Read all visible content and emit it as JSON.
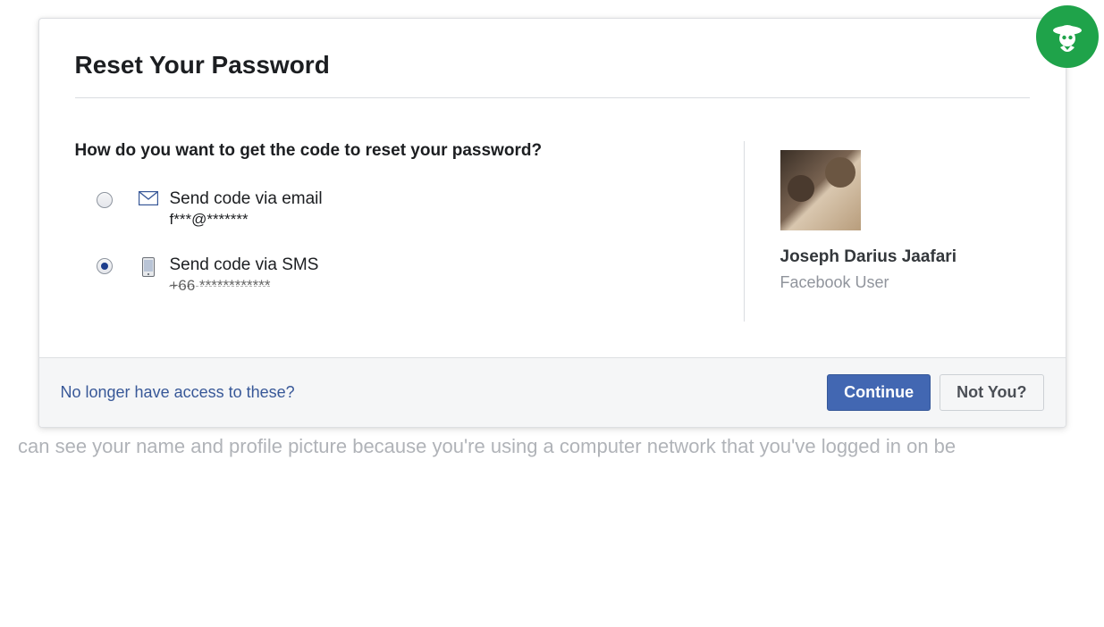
{
  "title": "Reset Your Password",
  "prompt": "How do you want to get the code to reset your password?",
  "options": {
    "email": {
      "label": "Send code via email",
      "detail": "f***@*******",
      "selected": false
    },
    "sms": {
      "label": "Send code via SMS",
      "detail": "+66 ************",
      "selected": true
    }
  },
  "user": {
    "name": "Joseph Darius Jaafari",
    "role": "Facebook User"
  },
  "footer": {
    "no_access_link": "No longer have access to these?",
    "continue_label": "Continue",
    "not_you_label": "Not You?"
  },
  "below_text": "can see your name and profile picture because you're using a computer network that you've logged in on be"
}
